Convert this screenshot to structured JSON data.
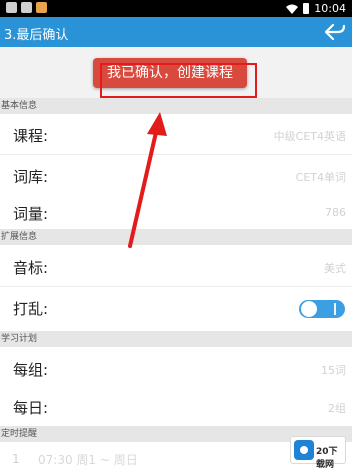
{
  "status_bar": {
    "time": "10:04",
    "icons": [
      "notification-icon",
      "notification-icon",
      "app-icon",
      "wifi-icon",
      "battery-icon"
    ]
  },
  "header": {
    "title": "3.最后确认",
    "back_icon": "back-arrow-icon"
  },
  "confirm_button": {
    "label": "我已确认，创建课程"
  },
  "sections": {
    "basic": {
      "title": "基本信息",
      "rows": [
        {
          "label": "课程:",
          "value": "中级CET4英语"
        },
        {
          "label": "词库:",
          "value": "CET4单词"
        },
        {
          "label": "词量:",
          "value": "786"
        }
      ]
    },
    "extended": {
      "title": "扩展信息",
      "rows": [
        {
          "label": "音标:",
          "value": "美式"
        },
        {
          "label": "打乱:",
          "toggle_on": true
        }
      ]
    },
    "plan": {
      "title": "学习计划",
      "rows": [
        {
          "label": "每组:",
          "value": "15词"
        },
        {
          "label": "每日:",
          "value": "2组"
        }
      ]
    },
    "reminder": {
      "title": "定时提醒",
      "item_number": "1",
      "item_time": "07:30 周1 ~ 周日"
    }
  },
  "watermark": {
    "text": "20下载网"
  },
  "colors": {
    "appbar": "#2a93d8",
    "confirm_button": "#d94a3e",
    "annotation": "#e21b1b",
    "toggle": "#3b9fe2"
  }
}
